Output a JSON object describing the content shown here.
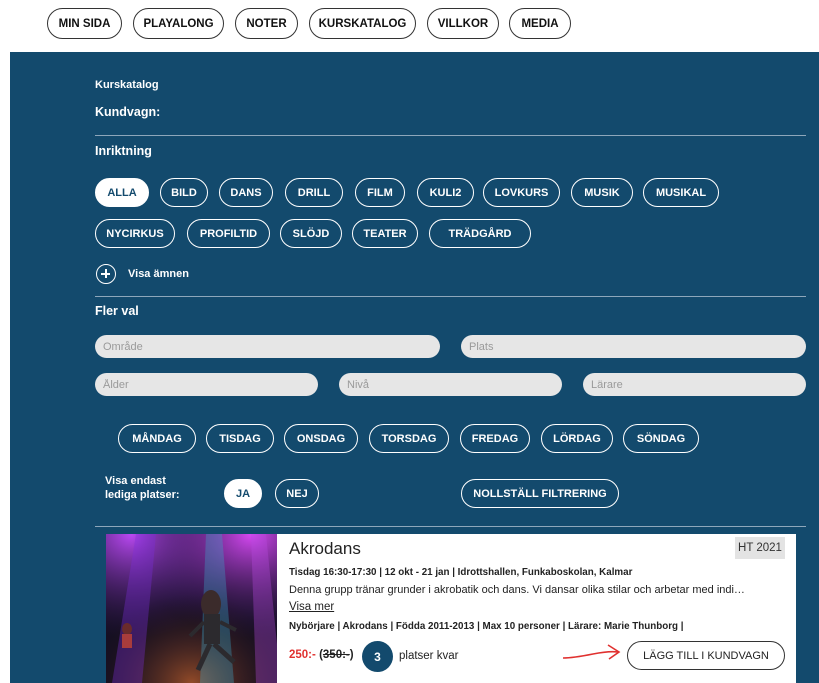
{
  "top_nav": {
    "items": [
      "MIN SIDA",
      "PLAYALONG",
      "NOTER",
      "KURSKATALOG",
      "VILLKOR",
      "MEDIA"
    ]
  },
  "panel": {
    "catalog_title": "Kurskatalog",
    "cart_label": "Kundvagn:",
    "orientation_heading": "Inriktning",
    "subjects": [
      "ALLA",
      "BILD",
      "DANS",
      "DRILL",
      "FILM",
      "KULI2",
      "LOVKURS",
      "MUSIK",
      "MUSIKAL",
      "NYCIRKUS",
      "PROFILTID",
      "SLÖJD",
      "TEATER",
      "TRÄDGÅRD"
    ],
    "active_subject": "ALLA",
    "show_subjects_label": "Visa ämnen",
    "more_options_heading": "Fler val",
    "placeholders": {
      "area": "Område",
      "place": "Plats",
      "age": "Ålder",
      "level": "Nivå",
      "teacher": "Lärare"
    },
    "weekdays": [
      "MÅNDAG",
      "TISDAG",
      "ONSDAG",
      "TORSDAG",
      "FREDAG",
      "LÖRDAG",
      "SÖNDAG"
    ],
    "vacant_label_line1": "Visa endast",
    "vacant_label_line2": "lediga platser:",
    "yes_label": "JA",
    "no_label": "NEJ",
    "reset_label": "NOLLSTÄLL FILTRERING"
  },
  "course": {
    "title": "Akrodans",
    "term_badge": "HT 2021",
    "schedule": "Tisdag 16:30-17:30 | 12 okt - 21 jan | Idrottshallen, Funkaboskolan, Kalmar",
    "description": "Denna grupp tränar grunder i akrobatik och dans. Vi dansar olika stilar och arbetar med indi…",
    "read_more": "Visa mer",
    "meta": "Nybörjare | Akrodans | Födda 2011-2013 | Max 10 personer | Lärare: Marie Thunborg |",
    "price": "250:-",
    "old_price": "350:-",
    "spots_left": "3",
    "spots_label": "platser kvar",
    "add_to_cart": "LÄGG TILL I KUNDVAGN"
  },
  "colors": {
    "panel_bg": "#134a6d",
    "price_red": "#e0312f",
    "arrow_red": "#e0312f"
  }
}
